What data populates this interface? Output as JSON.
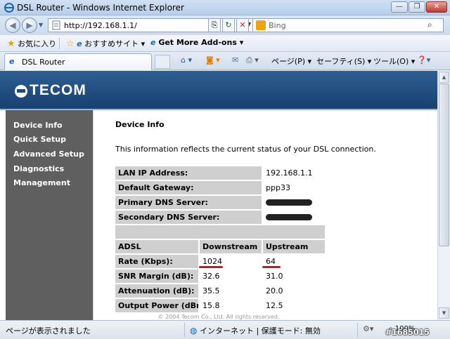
{
  "window": {
    "title": "DSL Router - Windows Internet Explorer",
    "min_glyph": "—",
    "max_glyph": "❐",
    "close_glyph": "✕"
  },
  "address_bar": {
    "url": "http://192.168.1.1/",
    "search_placeholder": "Bing"
  },
  "favorites_bar": {
    "favorites_label": "お気に入り",
    "recommended_label": "おすすめサイト ▾",
    "addons_label": "Get More Add-ons ▾"
  },
  "tab": {
    "label": "DSL Router"
  },
  "command_bar": {
    "page_label": "ページ(P) ▾",
    "safety_label": "セーフティ(S) ▾",
    "tools_label": "ツール(O) ▾",
    "help_label": "❓▾"
  },
  "page": {
    "brand": "TECOM",
    "menu": [
      "Device Info",
      "Quick Setup",
      "Advanced Setup",
      "Diagnostics",
      "Management"
    ],
    "title": "Device Info",
    "description": "This information reflects the current status of your DSL connection.",
    "lan_rows": [
      {
        "label": "LAN IP Address:",
        "value": "192.168.1.1"
      },
      {
        "label": "Default Gateway:",
        "value": "ppp33"
      },
      {
        "label": "Primary DNS Server:",
        "value": ""
      },
      {
        "label": "Secondary DNS Server:",
        "value": ""
      }
    ],
    "adsl_headers": [
      "ADSL",
      "Downstream",
      "Upstream"
    ],
    "adsl_rows": [
      {
        "label": "Rate (Kbps):",
        "down": "1024",
        "up": "64"
      },
      {
        "label": "SNR Margin (dB):",
        "down": "32.6",
        "up": "31.0"
      },
      {
        "label": "Attenuation (dB):",
        "down": "35.5",
        "up": "20.0"
      },
      {
        "label": "Output Power (dBm):",
        "down": "15.8",
        "up": "12.5"
      }
    ],
    "copyright": "© 2004 Tecom Co., Ltd. All rights reserved."
  },
  "status_bar": {
    "status_text": "ページが表示されました",
    "zone_text": "インターネット | 保護モード: 無効",
    "zoom": "100%"
  },
  "watermark": "#1685015",
  "colors": {
    "banner": "#1f4c7f",
    "sidebar": "#5f5f5f",
    "label_cell": "#cfcfcf",
    "highlight": "#e01010"
  }
}
